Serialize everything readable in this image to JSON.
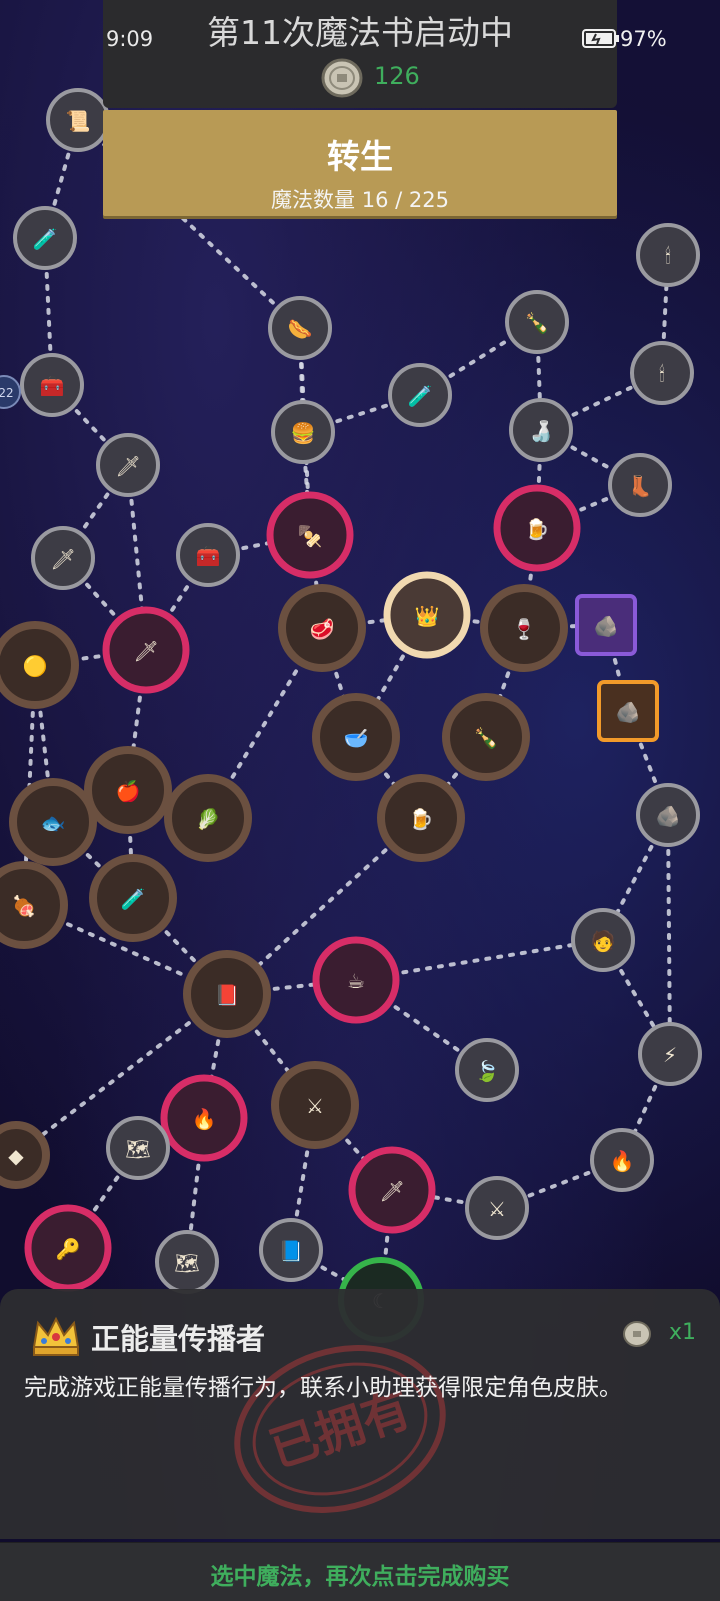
{
  "status_bar": {
    "time": "9:09",
    "battery": "97%"
  },
  "header": {
    "title": "第11次魔法书启动中",
    "coins": "126",
    "coin_icon": "coin-icon"
  },
  "rebirth": {
    "label": "转生",
    "count_text": "魔法数量 16 / 225"
  },
  "map": {
    "badge_text": "22",
    "nodes": [
      {
        "icon": "scroll-icon",
        "glyph": "📜",
        "style": "gray"
      },
      {
        "icon": "poison-flask-icon",
        "glyph": "🧪",
        "style": "gray"
      },
      {
        "icon": "treasure-chest-icon",
        "glyph": "🧰",
        "style": "gray"
      },
      {
        "icon": "hotdog-icon",
        "glyph": "🌭",
        "style": "gray"
      },
      {
        "icon": "burger-icon",
        "glyph": "🍔",
        "style": "gray"
      },
      {
        "icon": "mana-potion-icon",
        "glyph": "🧪",
        "style": "gray"
      },
      {
        "icon": "bottle-icon",
        "glyph": "🍾",
        "style": "gray"
      },
      {
        "icon": "brown-bottle-icon",
        "glyph": "🍶",
        "style": "gray"
      },
      {
        "icon": "candle-icon",
        "glyph": "🕯",
        "style": "gray"
      },
      {
        "icon": "small-candle-icon",
        "glyph": "🕯",
        "style": "gray"
      },
      {
        "icon": "boots-icon",
        "glyph": "👢",
        "style": "gray"
      },
      {
        "icon": "sword-icon",
        "glyph": "🗡",
        "style": "gray"
      },
      {
        "icon": "dagger-icon",
        "glyph": "🗡",
        "style": "gray"
      },
      {
        "icon": "toolbox-icon",
        "glyph": "🧰",
        "style": "gray"
      },
      {
        "icon": "kebab-icon",
        "glyph": "🍢",
        "style": "pink"
      },
      {
        "icon": "beer-icon",
        "glyph": "🍺",
        "style": "pink"
      },
      {
        "icon": "red-sword-icon",
        "glyph": "🗡",
        "style": "pink"
      },
      {
        "icon": "steak-icon",
        "glyph": "🥩",
        "style": "brown"
      },
      {
        "icon": "crown-icon",
        "glyph": "👑",
        "style": "selected"
      },
      {
        "icon": "wine-bottle-icon",
        "glyph": "🍷",
        "style": "brown"
      },
      {
        "icon": "coal-icon",
        "glyph": "🪨",
        "style": "purple"
      },
      {
        "icon": "coal-orange-icon",
        "glyph": "🪨",
        "style": "orange"
      },
      {
        "icon": "slime-icon",
        "glyph": "🟡",
        "style": "brown"
      },
      {
        "icon": "soup-icon",
        "glyph": "🥣",
        "style": "brown"
      },
      {
        "icon": "green-bottle-icon",
        "glyph": "🍾",
        "style": "brown"
      },
      {
        "icon": "apple-icon",
        "glyph": "🍎",
        "style": "brown"
      },
      {
        "icon": "cabbage-icon",
        "glyph": "🥬",
        "style": "brown"
      },
      {
        "icon": "mug-icon",
        "glyph": "🍺",
        "style": "brown"
      },
      {
        "icon": "coal-gray-icon",
        "glyph": "🪨",
        "style": "gray"
      },
      {
        "icon": "fish-icon",
        "glyph": "🐟",
        "style": "brown"
      },
      {
        "icon": "blue-potion-icon",
        "glyph": "🧪",
        "style": "brown"
      },
      {
        "icon": "meat-icon",
        "glyph": "🍖",
        "style": "brown"
      },
      {
        "icon": "adventurer-icon",
        "glyph": "🧑",
        "style": "gray"
      },
      {
        "icon": "spellbook-icon",
        "glyph": "📕",
        "style": "brown"
      },
      {
        "icon": "coffee-icon",
        "glyph": "☕",
        "style": "pink"
      },
      {
        "icon": "leaf-icon",
        "glyph": "🍃",
        "style": "gray"
      },
      {
        "icon": "lightning-sword-icon",
        "glyph": "⚡",
        "style": "gray"
      },
      {
        "icon": "torch-icon",
        "glyph": "🔥",
        "style": "pink"
      },
      {
        "icon": "crossed-swords-icon",
        "glyph": "⚔",
        "style": "brown"
      },
      {
        "icon": "green-rune-icon",
        "glyph": "◆",
        "style": "brown"
      },
      {
        "icon": "treasure-map-icon",
        "glyph": "🗺",
        "style": "gray"
      },
      {
        "icon": "flame-blade-icon",
        "glyph": "🗡",
        "style": "pink"
      },
      {
        "icon": "fire-burst-icon",
        "glyph": "🔥",
        "style": "gray"
      },
      {
        "icon": "golden-key-icon",
        "glyph": "🔑",
        "style": "pink"
      },
      {
        "icon": "old-map-icon",
        "glyph": "🗺",
        "style": "gray"
      },
      {
        "icon": "magic-tome-icon",
        "glyph": "📘",
        "style": "gray"
      },
      {
        "icon": "blue-sword-burst-icon",
        "glyph": "⚔",
        "style": "gray"
      },
      {
        "icon": "moon-icon",
        "glyph": "☾",
        "style": "green"
      }
    ]
  },
  "detail": {
    "title": "正能量传播者",
    "icon": "crown-icon",
    "coin_icon": "coin-icon",
    "quantity": "x1",
    "description": "完成游戏正能量传播行为，联系小助理获得限定角色皮肤。",
    "stamp_text": "已拥有"
  },
  "footer": {
    "hint": "选中魔法，再次点击完成购买"
  },
  "colors": {
    "accent_green": "#3fae5d",
    "gold_button": "#b89a55",
    "panel_dark": "#2b2b2d",
    "pink_ring": "#e0306a",
    "brown_ring": "#6b5040",
    "selected_ring": "#f1d9b0",
    "background": "#140f34"
  }
}
